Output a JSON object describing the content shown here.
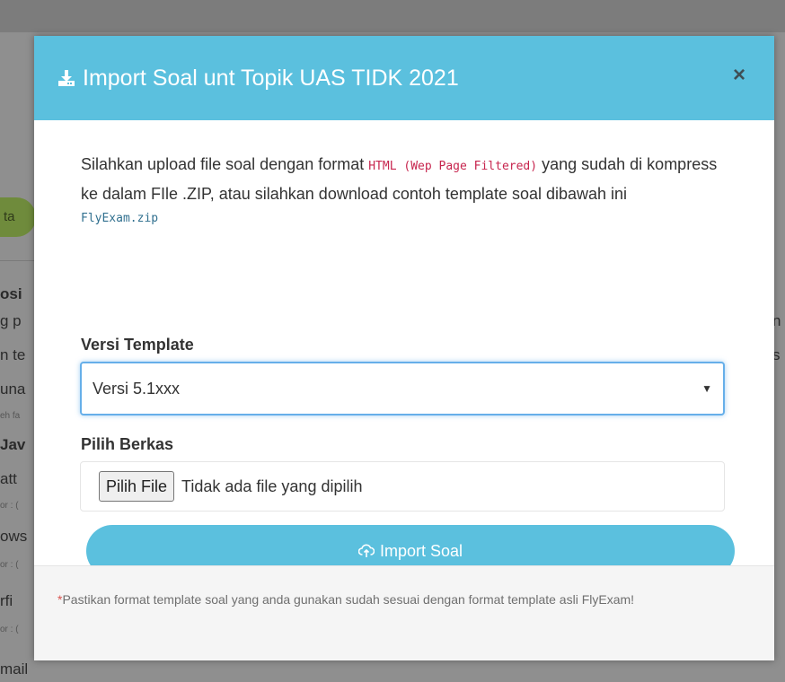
{
  "backdrop": {
    "badge_text": "ta",
    "lines": [
      "osi",
      "g p",
      "n te",
      "una",
      "eh fa",
      "Jav",
      "att",
      "or : (",
      "ows",
      "or : (",
      "rfi",
      "or : (",
      "mail"
    ],
    "right_text": [
      "n",
      "s"
    ]
  },
  "modal": {
    "title": "Import Soal unt Topik UAS TIDK 2021",
    "close_label": "×",
    "intro_text_1": "Silahkan upload file soal dengan format",
    "format_code": "HTML (Wep Page Filtered)",
    "intro_text_2": "yang sudah di kompress ke dalam FIle .ZIP, atau silahkan download contoh template soal dibawah ini",
    "template_link": "FlyExam.zip",
    "version_label": "Versi Template",
    "version_selected": "Versi 5.1xxx",
    "file_label": "Pilih Berkas",
    "file_button": "Pilih File",
    "file_status": "Tidak ada file yang dipilih",
    "import_button": "Import Soal",
    "footer_note": "*Pastikan format template soal yang anda gunakan sudah sesuai dengan format template asli FlyExam!"
  },
  "colors": {
    "header_bg": "#5bc0de",
    "accent": "#5bc0de",
    "code_color": "#c7254e",
    "link_color": "#31708f"
  },
  "icons": {
    "title": "download-icon",
    "import": "cloud-upload-icon",
    "close": "close-icon",
    "select_caret": "caret-down-icon"
  }
}
